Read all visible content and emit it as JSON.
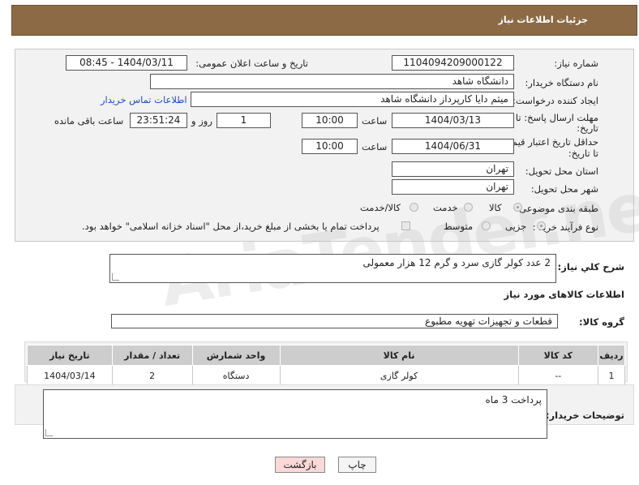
{
  "header": {
    "title": "جزئیات اطلاعات نیاز"
  },
  "form": {
    "need_number_label": "شماره نیاز:",
    "need_number": "1104094209000122",
    "announce_label": "تاریخ و ساعت اعلان عمومی:",
    "announce_value": "1404/03/11 - 08:45",
    "buyer_org_label": "نام دستگاه خریدار:",
    "buyer_org": "دانشگاه شاهد",
    "creator_label": "ایجاد کننده درخواست:",
    "creator": "میثم دایا کارپرداز دانشگاه شاهد",
    "contact_link": "اطلاعات تماس خریدار",
    "deadline_label_1": "مهلت ارسال پاسخ: تا",
    "deadline_label_2": "تاریخ:",
    "deadline_date": "1404/03/13",
    "time_label": "ساعت",
    "deadline_time": "10:00",
    "days_value": "1",
    "days_label": "روز و",
    "remaining_time": "23:51:24",
    "remaining_label": "ساعت باقی مانده",
    "validity_label_1": "حداقل تاریخ اعتبار قیمت:",
    "validity_label_2": "تا تاریخ:",
    "validity_date": "1404/06/31",
    "validity_time": "10:00",
    "province_label": "استان محل تحویل:",
    "province": "تهران",
    "city_label": "شهر محل تحویل:",
    "city": "تهران",
    "category_label": "طبقه بندی موضوعی:",
    "category_options": [
      "کالا",
      "خدمت",
      "کالا/خدمت"
    ],
    "process_label": "نوع فرآیند خرید :",
    "process_options": [
      "جزیی",
      "متوسط"
    ],
    "payment_note": "پرداخت تمام یا بخشی از مبلغ خرید،از محل \"اسناد خزانه اسلامی\" خواهد بود."
  },
  "summary": {
    "label": "شرح کلي نياز:",
    "text": "2 عدد کولر گازی سرد و گرم 12 هزار معمولی"
  },
  "goods": {
    "section_title": "اطلاعات کالاهای مورد نیاز",
    "group_label": "گروه کالا:",
    "group_value": "قطعات و تجهیزات تهویه مطبوع",
    "columns": [
      "ردیف",
      "کد کالا",
      "نام کالا",
      "واحد شمارش",
      "تعداد / مقدار",
      "تاریخ نیاز"
    ],
    "rows": [
      [
        "1",
        "--",
        "کولر گازی",
        "دستگاه",
        "2",
        "1404/03/14"
      ]
    ]
  },
  "buyer_notes": {
    "label": "توضیحات خریدار:",
    "text": "پرداخت 3 ماه"
  },
  "buttons": {
    "print": "چاپ",
    "back": "بازگشت"
  },
  "watermark": "AriaTender.net",
  "colors": {
    "header_bg": "#8b6a45",
    "link": "#1f4fb5",
    "back_btn_bg": "#fbd9d9"
  }
}
